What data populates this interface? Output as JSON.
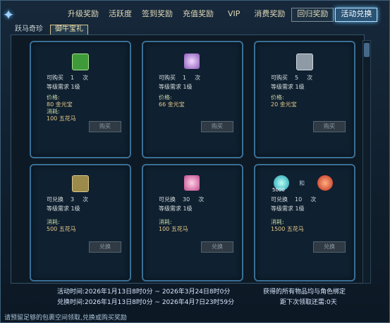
{
  "topbar": {
    "tabs": [
      "升级奖励",
      "活跃度",
      "签到奖励",
      "充值奖励",
      "VIP",
      "消费奖励",
      "回归奖励",
      "活动兑换"
    ]
  },
  "subtabs": [
    "跃马奇珍",
    "御牛宝礼"
  ],
  "cards": [
    {
      "count_label": "可购买",
      "count": "1",
      "count_unit": "次",
      "level": "等级需求 1级",
      "price_label": "价格:",
      "price": "80 金元宝",
      "cost_label": "消耗:",
      "cost": "100 五花马",
      "button": "购买"
    },
    {
      "count_label": "可购买",
      "count": "1",
      "count_unit": "次",
      "level": "等级需求 1级",
      "price_label": "价格:",
      "price": "66 金元宝",
      "cost_label": "",
      "cost": "",
      "button": "购买"
    },
    {
      "count_label": "可购买",
      "count": "5",
      "count_unit": "次",
      "level": "等级需求 1级",
      "price_label": "价格:",
      "price": "20 金元宝",
      "cost_label": "",
      "cost": "",
      "button": "购买"
    },
    {
      "count_label": "可兑换",
      "count": "3",
      "count_unit": "次",
      "level": "等级需求 1级",
      "cost_label": "消耗:",
      "cost": "500 五花马",
      "button": "兑换"
    },
    {
      "count_label": "可兑换",
      "count": "30",
      "count_unit": "次",
      "level": "等级需求 1级",
      "cost_label": "消耗:",
      "cost": "100 五花马",
      "button": "兑换"
    },
    {
      "count_label": "可兑换",
      "count": "10",
      "count_unit": "次",
      "level": "等级需求 1级",
      "cost_label": "消耗:",
      "cost": "1500 五花马",
      "button": "兑换",
      "item_qty": "5000",
      "item_join": "和"
    }
  ],
  "footer": {
    "activity_time": "活动时间:2026年1月13日8时0分 ~ 2026年3月24日8时0分",
    "exchange_time": "兑换时间:2026年1月13日8时0分 ~ 2026年4月7日23时59分",
    "bind_note": "获得的所有物品均与角色绑定",
    "claim_note": "距下次领取还需:0天",
    "bottom_tip": "请预留足够的包裹空间领取,兑换或购买奖励"
  },
  "colors": {
    "card_border": "#3a6f96",
    "active_tab": "#2a5476",
    "price": "#e6c98a"
  }
}
